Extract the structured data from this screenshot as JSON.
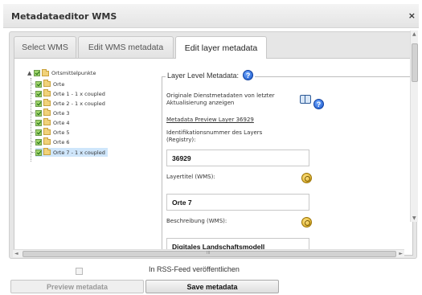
{
  "dialog": {
    "title": "Metadataeditor WMS",
    "close_label": "×"
  },
  "tabs": [
    {
      "label": "Select WMS"
    },
    {
      "label": "Edit WMS metadata"
    },
    {
      "label": "Edit layer metadata",
      "active": true
    }
  ],
  "tree": {
    "root": {
      "label": "Ortsmittelpunkte",
      "expander": "▲"
    },
    "nodes": [
      {
        "label": "Orte"
      },
      {
        "label": "Orte 1 - 1 x coupled"
      },
      {
        "label": "Orte 2 - 1 x coupled"
      },
      {
        "label": "Orte 3"
      },
      {
        "label": "Orte 4"
      },
      {
        "label": "Orte 5"
      },
      {
        "label": "Orte 6"
      },
      {
        "label": "Orte 7 - 1 x coupled",
        "selected": true
      }
    ]
  },
  "layer_metadata": {
    "legend": "Layer Level Metadata:",
    "original_metadata_label": "Originale Dienstmetadaten von letzter Aktualisierung anzeigen",
    "preview_link": "Metadata Preview Layer 36929",
    "id_label": "Identifikationsnummer des Layers (Registry):",
    "id_value": "36929",
    "title_label": "Layertitel (WMS):",
    "title_value": "Orte 7",
    "description_label": "Beschreibung (WMS):",
    "description_value": "Digitales Landschaftsmodell"
  },
  "footer": {
    "rss_label": "In RSS-Feed veröffentlichen",
    "preview_button": "Preview metadata",
    "save_button": "Save metadata"
  },
  "scrollbar": {
    "h_thumb_label": "III",
    "v_thumb_label": "≡"
  },
  "colors": {
    "help_icon": "#1a56c8",
    "selected_node": "#cfe6fb",
    "checkbox_green": "#9ed36a"
  }
}
